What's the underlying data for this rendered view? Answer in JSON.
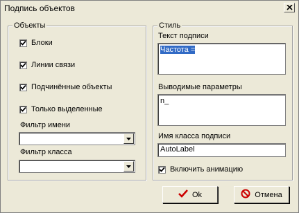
{
  "window": {
    "title": "Подпись объектов"
  },
  "objects_group": {
    "legend": "Объекты",
    "checkboxes": [
      {
        "label": "Блоки",
        "checked": true
      },
      {
        "label": "Линии связи",
        "checked": true
      },
      {
        "label": "Подчинённые объекты",
        "checked": true
      },
      {
        "label": "Только выделенные",
        "checked": true
      }
    ],
    "name_filter_label": "Фильтр имени",
    "name_filter_value": "",
    "class_filter_label": "Фильтр класса",
    "class_filter_value": ""
  },
  "style_group": {
    "legend": "Стиль",
    "caption_text_label": "Текст подписи",
    "caption_text_value": "Частота =",
    "output_params_label": "Выводимые параметры",
    "output_params_value": "n_",
    "caption_class_label": "Имя класса подписи",
    "caption_class_value": "AutoLabel",
    "animation_label": "Включить анимацию",
    "animation_checked": true
  },
  "buttons": {
    "ok": "Ok",
    "cancel": "Отмена"
  },
  "colors": {
    "selection": "#316ac5",
    "ok_check": "#cc0000",
    "cancel_icon": "#cc0000"
  }
}
